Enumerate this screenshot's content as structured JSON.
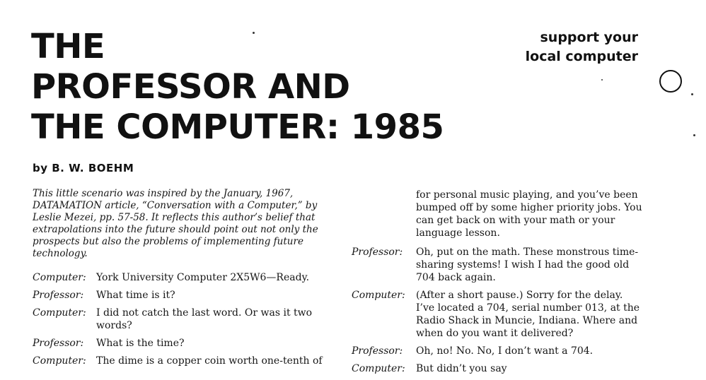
{
  "article": {
    "title_lines": [
      "THE",
      "PROFESSOR AND",
      "THE COMPUTER: 1985"
    ],
    "byline": "by B. W. BOEHM",
    "tagline_lines": [
      "support your",
      "local computer"
    ],
    "intro": "This little scenario was inspired by the January, 1967, DATAMATION article, “Conversation with a Computer,” by Leslie Mezei, pp. 57-58. It reflects this author’s belief that extrapolations into the future should point out not only the prospects but also the problems of implementing future technology."
  },
  "left_column": [
    {
      "speaker": "Computer:",
      "text": "York University Computer 2X5W6—Ready."
    },
    {
      "speaker": "Professor:",
      "text": "What time is it?"
    },
    {
      "speaker": "Computer:",
      "text": "I did not catch the last word. Or was it two words?"
    },
    {
      "speaker": "Professor:",
      "text": "What is the time?"
    },
    {
      "speaker": "Computer:",
      "text": "The dime is a copper coin worth one-tenth of"
    }
  ],
  "right_column": {
    "continuation": "for personal music playing, and you’ve been bumped off by some higher priority jobs. You can get back on with your math or your language lesson.",
    "turns": [
      {
        "speaker": "Professor:",
        "text": "Oh, put on the math. These monstrous time-sharing systems! I wish I had the good old 704 back again."
      },
      {
        "speaker": "Computer:",
        "text": "(After a short pause.) Sorry for the delay. I’ve located a 704, serial number 013, at the Radio Shack in Muncie, Indiana. Where and when do you want it delivered?"
      },
      {
        "speaker": "Professor:",
        "text": "Oh, no! No. No, I don’t want a 704."
      },
      {
        "speaker": "Computer:",
        "text": "But didn’t you say"
      }
    ]
  }
}
